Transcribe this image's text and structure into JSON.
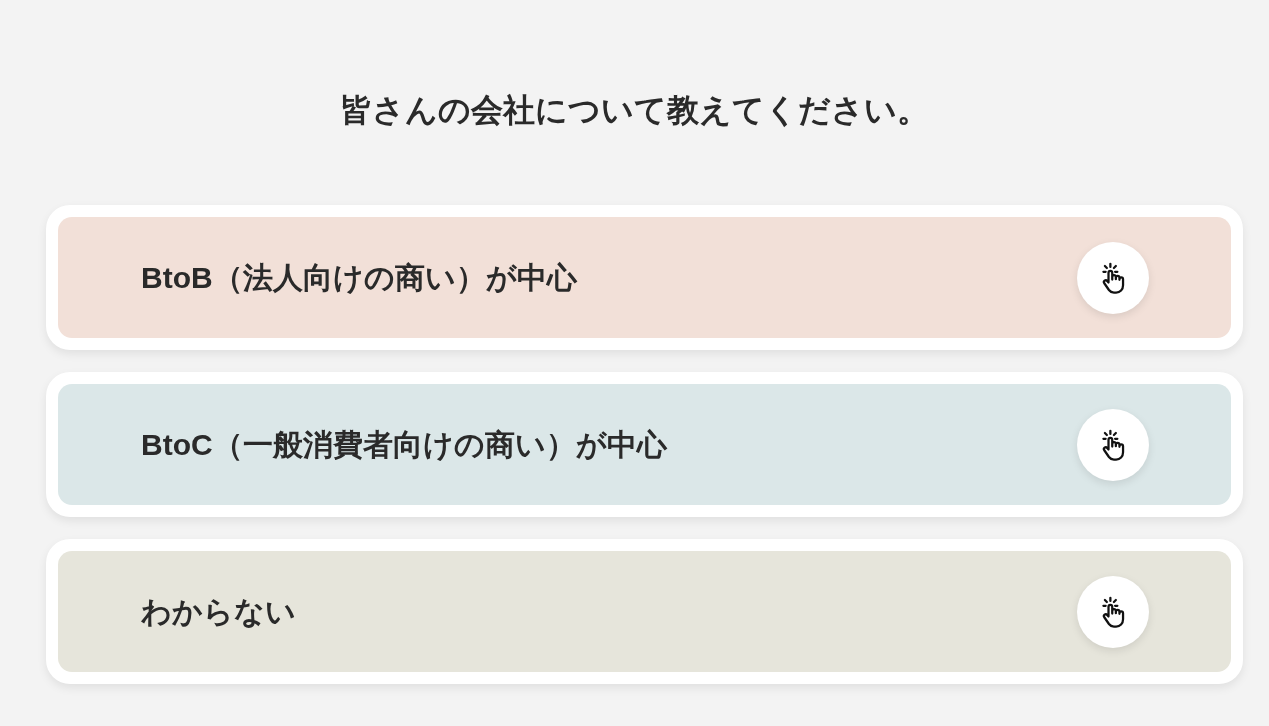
{
  "heading": "皆さんの会社について教えてください。",
  "options": [
    {
      "label": "BtoB（法人向けの商い）が中心",
      "color": "#f2e0d8"
    },
    {
      "label": "BtoC（一般消費者向けの商い）が中心",
      "color": "#dbe7e8"
    },
    {
      "label": "わからない",
      "color": "#e6e5db"
    }
  ]
}
